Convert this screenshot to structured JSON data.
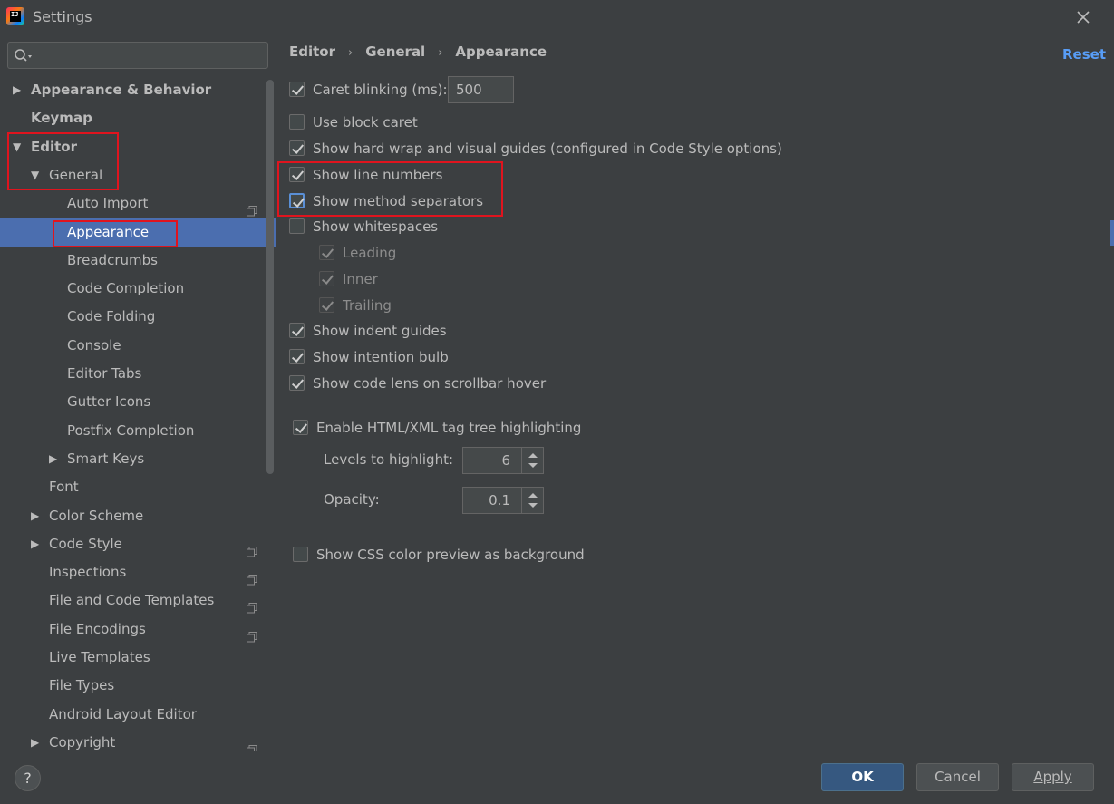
{
  "window": {
    "title": "Settings",
    "logo_text": "IJ"
  },
  "search": {
    "placeholder": ""
  },
  "tree": [
    {
      "label": "Appearance & Behavior",
      "bold": true,
      "arrow": "right",
      "level": 0
    },
    {
      "label": "Keymap",
      "bold": true,
      "arrow": "none",
      "level": 0
    },
    {
      "label": "Editor",
      "bold": true,
      "arrow": "down",
      "level": 0
    },
    {
      "label": "General",
      "bold": false,
      "arrow": "down",
      "level": 1
    },
    {
      "label": "Auto Import",
      "bold": false,
      "arrow": "none",
      "level": 2,
      "project_icon": true
    },
    {
      "label": "Appearance",
      "bold": false,
      "arrow": "none",
      "level": 2,
      "selected": true
    },
    {
      "label": "Breadcrumbs",
      "bold": false,
      "arrow": "none",
      "level": 2
    },
    {
      "label": "Code Completion",
      "bold": false,
      "arrow": "none",
      "level": 2
    },
    {
      "label": "Code Folding",
      "bold": false,
      "arrow": "none",
      "level": 2
    },
    {
      "label": "Console",
      "bold": false,
      "arrow": "none",
      "level": 2
    },
    {
      "label": "Editor Tabs",
      "bold": false,
      "arrow": "none",
      "level": 2
    },
    {
      "label": "Gutter Icons",
      "bold": false,
      "arrow": "none",
      "level": 2
    },
    {
      "label": "Postfix Completion",
      "bold": false,
      "arrow": "none",
      "level": 2
    },
    {
      "label": "Smart Keys",
      "bold": false,
      "arrow": "right",
      "level": 2
    },
    {
      "label": "Font",
      "bold": false,
      "arrow": "none",
      "level": 1
    },
    {
      "label": "Color Scheme",
      "bold": false,
      "arrow": "right",
      "level": 1
    },
    {
      "label": "Code Style",
      "bold": false,
      "arrow": "right",
      "level": 1,
      "project_icon": true
    },
    {
      "label": "Inspections",
      "bold": false,
      "arrow": "none",
      "level": 1,
      "project_icon": true
    },
    {
      "label": "File and Code Templates",
      "bold": false,
      "arrow": "none",
      "level": 1,
      "project_icon": true
    },
    {
      "label": "File Encodings",
      "bold": false,
      "arrow": "none",
      "level": 1,
      "project_icon": true
    },
    {
      "label": "Live Templates",
      "bold": false,
      "arrow": "none",
      "level": 1
    },
    {
      "label": "File Types",
      "bold": false,
      "arrow": "none",
      "level": 1
    },
    {
      "label": "Android Layout Editor",
      "bold": false,
      "arrow": "none",
      "level": 1
    },
    {
      "label": "Copyright",
      "bold": false,
      "arrow": "right",
      "level": 1,
      "project_icon": true
    }
  ],
  "breadcrumb": {
    "items": [
      "Editor",
      "General",
      "Appearance"
    ],
    "separator": "›"
  },
  "reset_label": "Reset",
  "options": {
    "caret_blinking": {
      "label": "Caret blinking (ms):",
      "checked": true,
      "value": "500"
    },
    "block_caret": {
      "label": "Use block caret",
      "checked": false
    },
    "hard_wrap": {
      "label": "Show hard wrap and visual guides (configured in Code Style options)",
      "checked": true
    },
    "line_numbers": {
      "label": "Show line numbers",
      "checked": true
    },
    "method_separators": {
      "label": "Show method separators",
      "checked": true
    },
    "whitespaces": {
      "label": "Show whitespaces",
      "checked": false
    },
    "leading": {
      "label": "Leading",
      "checked": true
    },
    "inner": {
      "label": "Inner",
      "checked": true
    },
    "trailing": {
      "label": "Trailing",
      "checked": true
    },
    "indent_guides": {
      "label": "Show indent guides",
      "checked": true
    },
    "intention_bulb": {
      "label": "Show intention bulb",
      "checked": true
    },
    "code_lens": {
      "label": "Show code lens on scrollbar hover",
      "checked": true
    },
    "tag_tree": {
      "label": "Enable HTML/XML tag tree highlighting",
      "checked": true
    },
    "levels": {
      "label": "Levels to highlight:",
      "value": "6"
    },
    "opacity": {
      "label": "Opacity:",
      "value": "0.1"
    },
    "css_preview": {
      "label": "Show CSS color preview as background",
      "checked": false
    }
  },
  "buttons": {
    "help": "?",
    "ok": "OK",
    "cancel": "Cancel",
    "apply": "Apply"
  },
  "colors": {
    "background": "#3c3f41",
    "selection": "#4b6eaf",
    "link": "#589df6",
    "highlight_box": "#e0141e",
    "primary_button": "#365880"
  }
}
